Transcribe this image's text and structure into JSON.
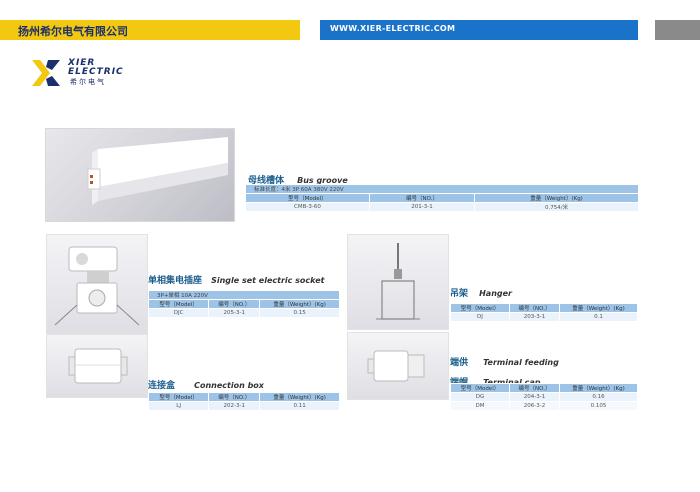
{
  "header": {
    "company_name": "扬州希尔电气有限公司",
    "website": "WWW.XIER-ELECTRIC.COM"
  },
  "logo": {
    "line1": "XIER",
    "line2": "ELECTRIC",
    "line3": "希尔电气"
  },
  "bus_groove": {
    "title_zh": "母线槽体",
    "title_en": "Bus groove",
    "spec_line": "标准长度：4米    3P    60A    380V    220V",
    "headers": [
      "型号（Model）",
      "编号（NO.）",
      "重量（Weight）(Kg)"
    ],
    "rows": [
      [
        "CMB-3-60",
        "201-3-1",
        "0.754/米"
      ]
    ]
  },
  "socket": {
    "title_zh": "单相集电插座",
    "title_en": "Single set electric socket",
    "spec_line": "3P+单相    10A    220V",
    "headers": [
      "型号（Model）",
      "编号（NO.）",
      "重量（Weight）(Kg)"
    ],
    "rows": [
      [
        "DJC",
        "205-3-1",
        "0.15"
      ]
    ]
  },
  "hanger": {
    "title_zh": "吊架",
    "title_en": "Hanger",
    "headers": [
      "型号（Model）",
      "编号（NO.）",
      "重量（Weight）(Kg)"
    ],
    "rows": [
      [
        "DJ",
        "203-3-1",
        "0.1"
      ]
    ]
  },
  "connection_box": {
    "title_zh": "连接盒",
    "title_en": "Connection box",
    "headers": [
      "型号（Model）",
      "编号（NO.）",
      "重量（Weight）(Kg)"
    ],
    "rows": [
      [
        "LJ",
        "202-3-1",
        "0.11"
      ]
    ]
  },
  "terminal": {
    "title_zh_1": "端供",
    "title_en_1": "Terminal feeding",
    "title_zh_2": "端帽",
    "title_en_2": "Terminal cap",
    "headers": [
      "型号（Model）",
      "编号（NO.）",
      "重量（Weight）(Kg)"
    ],
    "rows": [
      [
        "DG",
        "204-3-1",
        "0.16"
      ],
      [
        "DM",
        "206-3-2",
        "0.105"
      ]
    ]
  },
  "colors": {
    "accent_yellow": "#f2c811",
    "accent_blue": "#1a73c9",
    "table_blue": "#9dc3e6",
    "title_blue": "#1b5e8d"
  }
}
